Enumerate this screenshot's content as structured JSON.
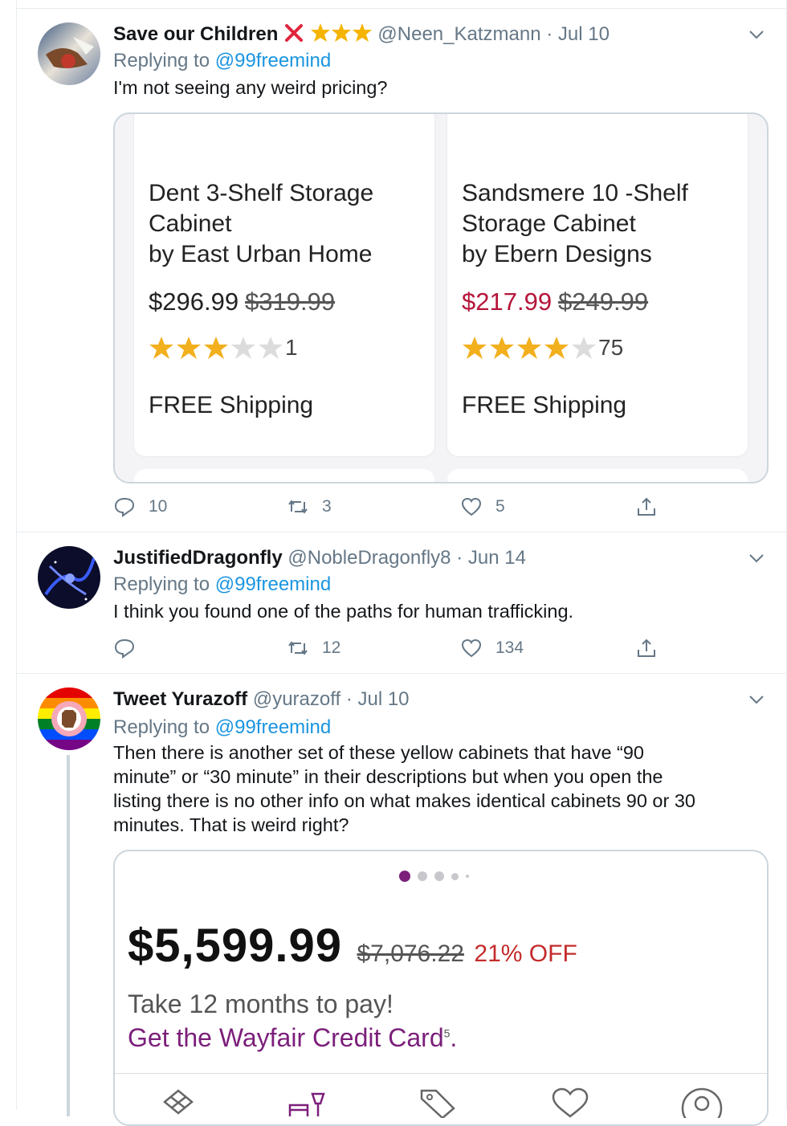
{
  "colors": {
    "link": "#1b95e0",
    "muted": "#657786",
    "sale": "#b5153a",
    "wayfair_purple": "#7b1f7a",
    "star": "#f2b01e"
  },
  "tweets": [
    {
      "name": "Save our Children",
      "badges": [
        "cross-mark-icon",
        "star-icon",
        "star-icon",
        "star-icon"
      ],
      "handle": "@Neen_Katzmann",
      "dot": "·",
      "date": "Jul 10",
      "replying_prefix": "Replying to",
      "replying_to": "@99freemind",
      "text": "I'm not seeing any weird pricing?",
      "card": {
        "products": [
          {
            "title_lines": [
              "Dent 3-Shelf Storage",
              "Cabinet",
              "by East Urban Home"
            ],
            "price": "$296.99",
            "old_price": "$319.99",
            "rating": 3,
            "rating_count": "1",
            "shipping": "FREE Shipping"
          },
          {
            "title_lines": [
              "Sandsmere 10 -Shelf",
              "Storage Cabinet",
              "by Ebern Designs"
            ],
            "price": "$217.99",
            "old_price": "$249.99",
            "rating": 4,
            "rating_count": "75",
            "shipping": "FREE Shipping"
          }
        ]
      },
      "actions": {
        "replies": "10",
        "retweets": "3",
        "likes": "5"
      }
    },
    {
      "name": "JustifiedDragonfly",
      "handle": "@NobleDragonfly8",
      "dot": "·",
      "date": "Jun 14",
      "replying_prefix": "Replying to",
      "replying_to": "@99freemind",
      "text": "I think you found one of the paths for human trafficking.",
      "actions": {
        "replies": "",
        "retweets": "12",
        "likes": "134"
      }
    },
    {
      "name": "Tweet Yurazoff",
      "handle": "@yurazoff",
      "dot": "·",
      "date": "Jul 10",
      "replying_prefix": "Replying to",
      "replying_to": "@99freemind",
      "text_lines": [
        "Then there is another set of these yellow cabinets that have “90",
        "minute” or “30 minute” in their descriptions but when you open the",
        "listing there is no other info on what makes identical cabinets 90 or 30",
        "minutes.  That is weird right?"
      ],
      "card": {
        "price": "$5,599.99",
        "old_price": "$7,076.22",
        "discount": "21% OFF",
        "months": "Take 12 months to pay!",
        "credit": "Get the Wayfair Credit Card",
        "credit_sup": "5",
        "credit_end": ".",
        "carousel_active": 1,
        "carousel_count": 5,
        "tab_icons": [
          "sale-tag-icon",
          "furniture-icon",
          "price-tag-icon",
          "heart-icon",
          "account-icon"
        ]
      }
    }
  ]
}
